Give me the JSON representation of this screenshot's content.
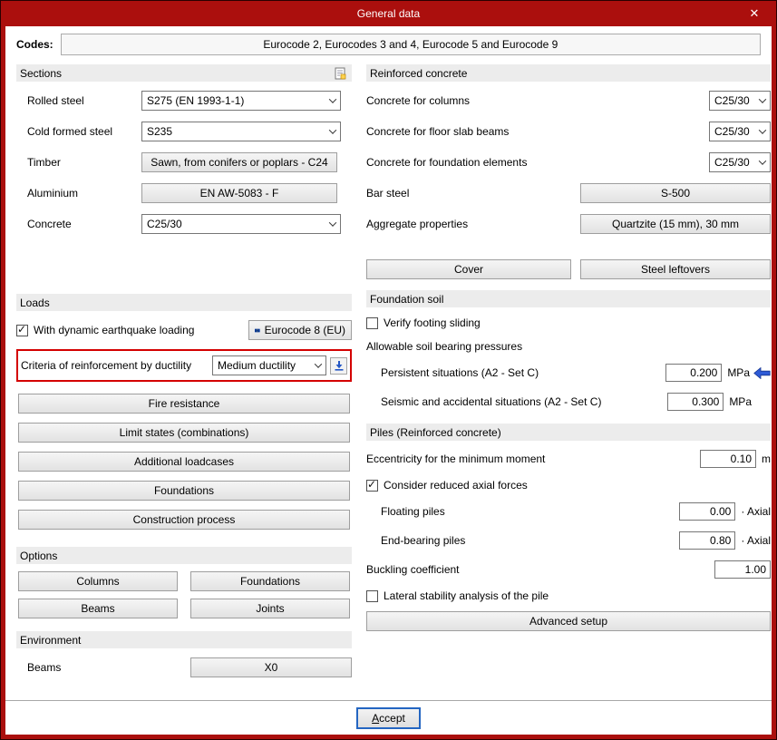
{
  "window": {
    "title": "General data",
    "close_icon": "✕"
  },
  "codes": {
    "label": "Codes:",
    "value": "Eurocode 2, Eurocodes 3 and 4, Eurocode 5 and Eurocode 9"
  },
  "sections": {
    "header": "Sections",
    "fields": [
      {
        "label": "Rolled steel",
        "value": "S275 (EN 1993-1-1)",
        "type": "select"
      },
      {
        "label": "Cold formed steel",
        "value": "S235",
        "type": "select"
      },
      {
        "label": "Timber",
        "value": "Sawn, from conifers or poplars - C24",
        "type": "button"
      },
      {
        "label": "Aluminium",
        "value": "EN AW-5083 - F",
        "type": "button"
      },
      {
        "label": "Concrete",
        "value": "C25/30",
        "type": "select"
      }
    ]
  },
  "loads": {
    "header": "Loads",
    "earthquake_checkbox": {
      "label": "With dynamic earthquake loading",
      "checked": true
    },
    "eurocode8_button": "Eurocode 8 (EU)",
    "ductility": {
      "label": "Criteria of reinforcement by ductility",
      "value": "Medium ductility"
    },
    "buttons": [
      "Fire resistance",
      "Limit states (combinations)",
      "Additional loadcases",
      "Foundations",
      "Construction process"
    ]
  },
  "options": {
    "header": "Options",
    "buttons": [
      "Columns",
      "Foundations",
      "Beams",
      "Joints"
    ]
  },
  "environment": {
    "header": "Environment",
    "label": "Beams",
    "value": "X0"
  },
  "reinforced_concrete": {
    "header": "Reinforced concrete",
    "selects": [
      {
        "label": "Concrete for columns",
        "value": "C25/30"
      },
      {
        "label": "Concrete for floor slab beams",
        "value": "C25/30"
      },
      {
        "label": "Concrete for foundation elements",
        "value": "C25/30"
      }
    ],
    "bar_steel": {
      "label": "Bar steel",
      "value": "S-500"
    },
    "aggregate": {
      "label": "Aggregate properties",
      "value": "Quartzite (15 mm), 30 mm"
    },
    "cover_button": "Cover",
    "steel_leftovers_button": "Steel leftovers"
  },
  "foundation_soil": {
    "header": "Foundation soil",
    "verify_checkbox": {
      "label": "Verify footing sliding",
      "checked": false
    },
    "pressures_label": "Allowable soil bearing pressures",
    "persistent": {
      "label": "Persistent situations (A2 - Set C)",
      "value": "0.200",
      "unit": "MPa"
    },
    "seismic": {
      "label": "Seismic and accidental situations (A2 - Set C)",
      "value": "0.300",
      "unit": "MPa"
    }
  },
  "piles": {
    "header": "Piles (Reinforced concrete)",
    "eccentricity": {
      "label": "Eccentricity for the minimum moment",
      "value": "0.10",
      "unit": "m"
    },
    "reduced_axial_checkbox": {
      "label": "Consider reduced axial forces",
      "checked": true
    },
    "floating": {
      "label": "Floating piles",
      "value": "0.00",
      "unit": "· Axial"
    },
    "end_bearing": {
      "label": "End-bearing piles",
      "value": "0.80",
      "unit": "· Axial"
    },
    "buckling": {
      "label": "Buckling coefficient",
      "value": "1.00"
    },
    "lateral_checkbox": {
      "label": "Lateral stability analysis of the pile",
      "checked": false
    },
    "advanced_button": "Advanced setup"
  },
  "footer": {
    "accept_first": "A",
    "accept_rest": "ccept"
  },
  "colors": {
    "titlebar_red": "#AB0F0D",
    "highlight_border": "#D40000",
    "accent_blue": "#2E5BD6",
    "focus_blue": "#2466C2",
    "group_header_bg": "#ECECEC"
  }
}
